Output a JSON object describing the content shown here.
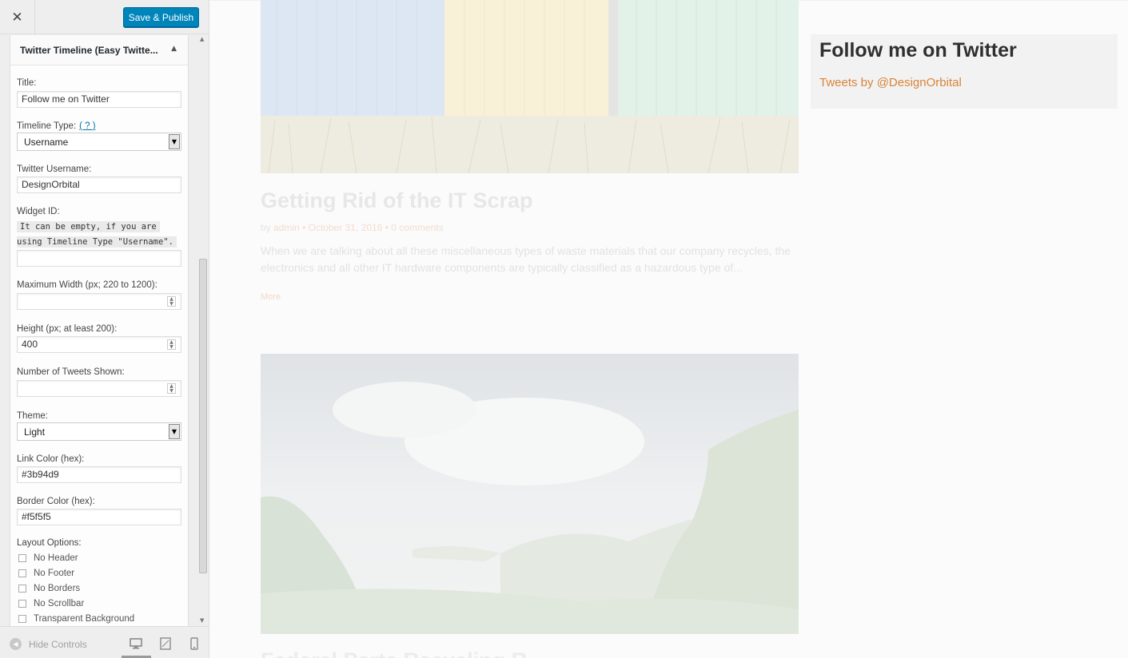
{
  "header": {
    "close_icon": "close-icon",
    "publish_label": "Save & Publish"
  },
  "widget": {
    "title": "Twitter Timeline (Easy Twitte...",
    "toggle_icon": "triangle-up-icon",
    "fields": {
      "title_label": "Title:",
      "title_value": "Follow me on Twitter",
      "timeline_type_label": "Timeline Type:",
      "timeline_type_help": "( ? )",
      "timeline_type_value": "Username",
      "username_label": "Twitter Username:",
      "username_value": "DesignOrbital",
      "widget_id_label": "Widget ID:",
      "widget_id_hint_1": "It can be empty, if you are",
      "widget_id_hint_2": "using Timeline Type \"Username\".",
      "widget_id_value": "",
      "max_width_label": "Maximum Width (px; 220 to 1200):",
      "max_width_value": "",
      "height_label": "Height (px; at least 200):",
      "height_value": "400",
      "tweets_label": "Number of Tweets Shown:",
      "tweets_value": "",
      "theme_label": "Theme:",
      "theme_value": "Light",
      "link_color_label": "Link Color (hex):",
      "link_color_value": "#3b94d9",
      "border_color_label": "Border Color (hex):",
      "border_color_value": "#f5f5f5",
      "layout_label": "Layout Options:",
      "layout_options": [
        "No Header",
        "No Footer",
        "No Borders",
        "No Scrollbar",
        "Transparent Background"
      ]
    }
  },
  "footer": {
    "hide_controls_label": "Hide Controls",
    "devices": [
      "desktop-icon",
      "tablet-icon",
      "mobile-icon"
    ]
  },
  "preview": {
    "post_title": "Getting Rid of the IT Scrap",
    "meta_by": "by",
    "meta_author": "admin",
    "meta_sep": "•",
    "meta_date": "October 31, 2016",
    "meta_comments": "0 comments",
    "excerpt": "When we are talking about all these miscellaneous types of waste materials that our company recycles, the electronics and all other IT hardware components are typically classified as a hazardous type of...",
    "more_label": "More",
    "next_title": "Federal Parts Recycling R...",
    "sidebar_widget_title": "Follow me on Twitter",
    "sidebar_widget_link": "Tweets by @DesignOrbital"
  },
  "colors": {
    "primary_button": "#0085ba",
    "accent_link": "#d8843a"
  }
}
